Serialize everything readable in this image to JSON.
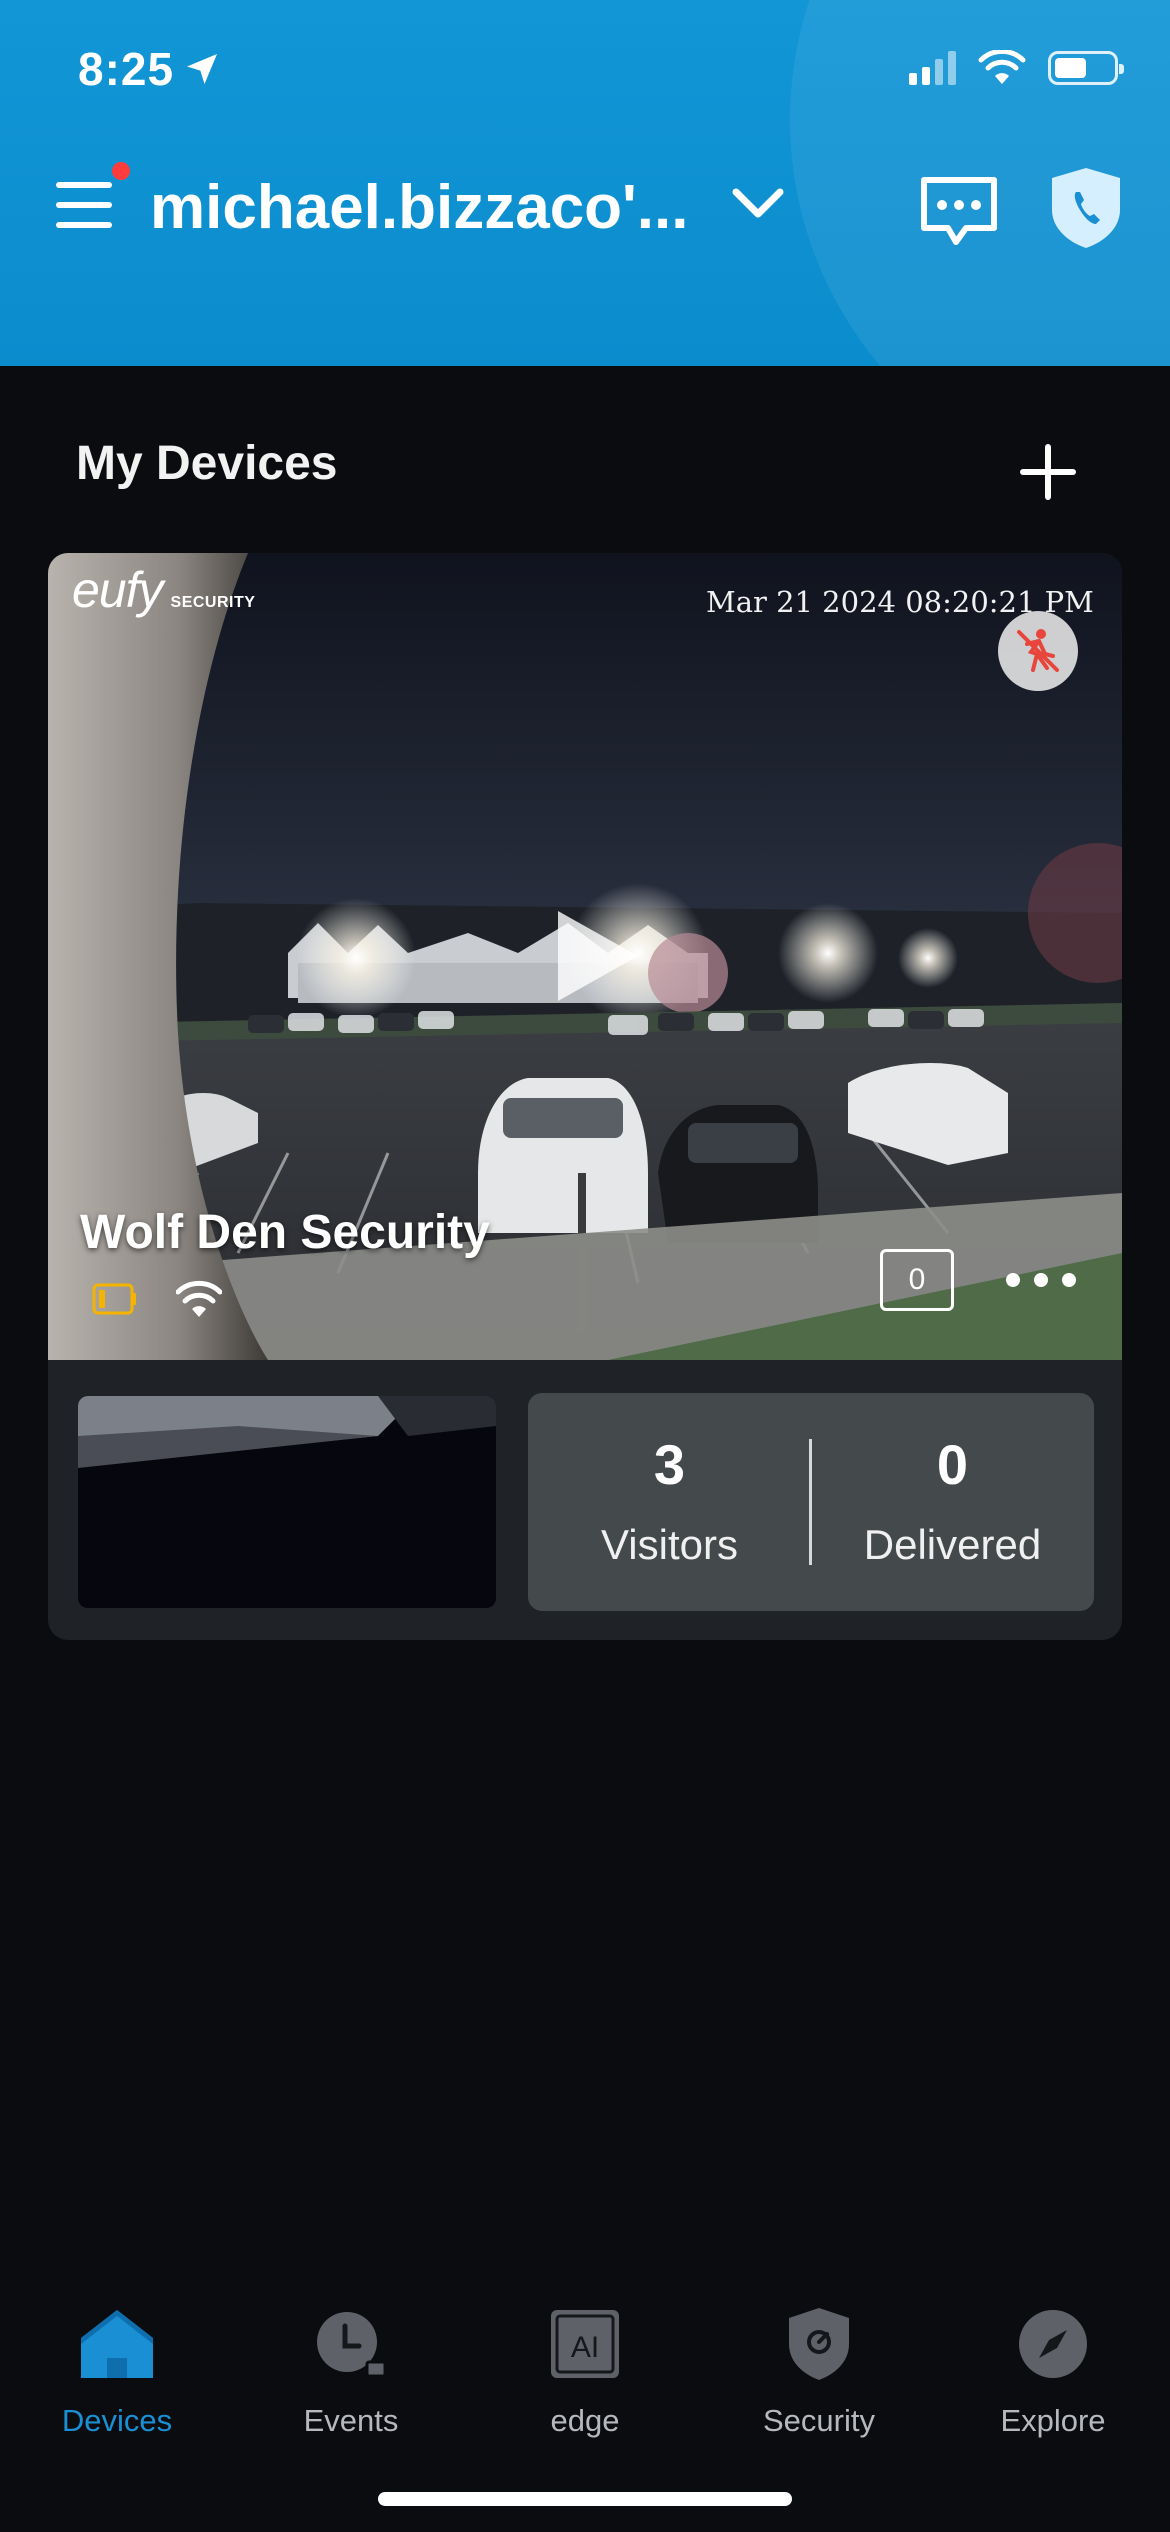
{
  "status_bar": {
    "time": "8:25"
  },
  "header": {
    "account_title": "michael.bizzaco'..."
  },
  "section": {
    "title": "My Devices"
  },
  "device": {
    "brand_logo": "eufy",
    "brand_sub": "SECURITY",
    "timestamp": "Mar 21 2024  08:20:21 PM",
    "name": "Wolf Den Security",
    "clip_count": "0",
    "stats": [
      {
        "value": "3",
        "label": "Visitors"
      },
      {
        "value": "0",
        "label": "Delivered"
      }
    ]
  },
  "tabs": [
    {
      "label": "Devices",
      "icon": "home-icon",
      "active": true
    },
    {
      "label": "Events",
      "icon": "events-clock-icon",
      "active": false
    },
    {
      "label": "edge",
      "icon": "ai-edge-icon",
      "active": false
    },
    {
      "label": "Security",
      "icon": "security-shield-icon",
      "active": false
    },
    {
      "label": "Explore",
      "icon": "compass-icon",
      "active": false
    }
  ],
  "colors": {
    "header_bg": "#0f93d3",
    "page_bg": "#0b0c10",
    "card_bg": "#1f2226",
    "stats_bg": "#444a4c",
    "active_tab": "#1a8fd4",
    "inactive_tab": "#b5b8bc",
    "notification_dot": "#ff3b3b",
    "battery_low": "#f5b400",
    "motion_icon": "#e8453c"
  }
}
